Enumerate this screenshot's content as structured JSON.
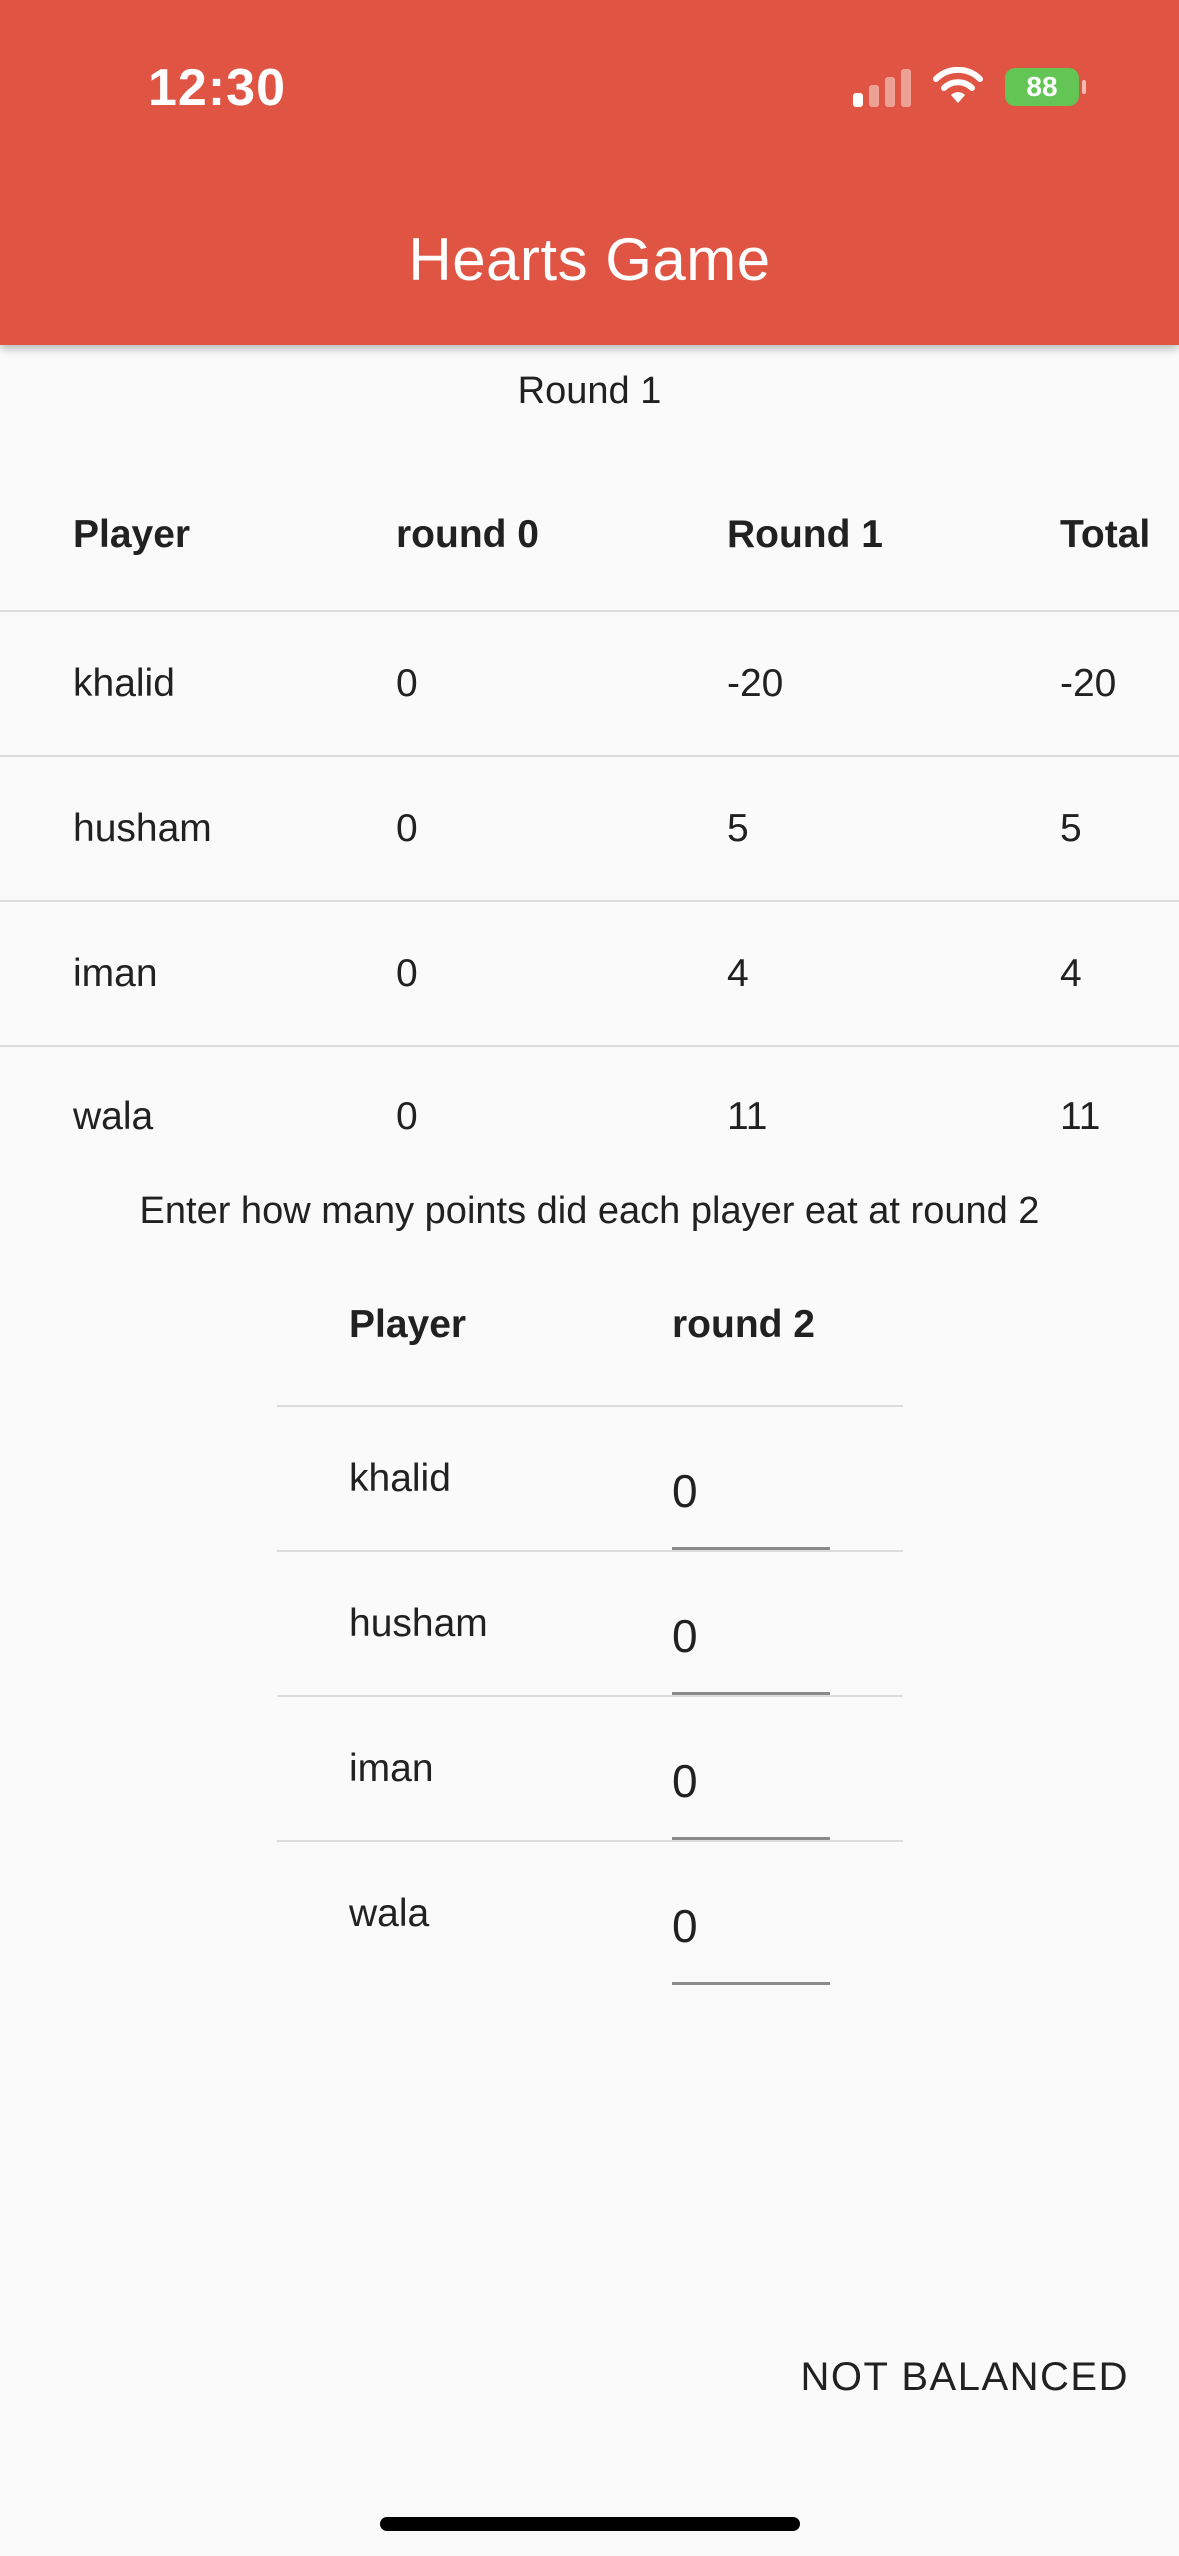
{
  "status_bar": {
    "time": "12:30",
    "battery": "88",
    "icons": [
      "cellular-signal-icon",
      "wifi-icon",
      "battery-charging-icon"
    ]
  },
  "app_bar": {
    "title": "Hearts Game",
    "color": "#e05443"
  },
  "round_caption": "Round 1",
  "score_table": {
    "headers": [
      "Player",
      "round 0",
      "Round 1",
      "Total"
    ],
    "rows": [
      [
        "khalid",
        "0",
        "-20",
        "-20"
      ],
      [
        "husham",
        "0",
        "5",
        "5"
      ],
      [
        "iman",
        "0",
        "4",
        "4"
      ],
      [
        "wala",
        "0",
        "11",
        "11"
      ]
    ]
  },
  "instructions": "Enter how many points did each player eat at round 2",
  "entry_table": {
    "headers": [
      "Player",
      "round 2"
    ],
    "rows": [
      {
        "player": "khalid",
        "value": "0"
      },
      {
        "player": "husham",
        "value": "0"
      },
      {
        "player": "iman",
        "value": "0"
      },
      {
        "player": "wala",
        "value": "0"
      }
    ]
  },
  "balance_status": "NOT BALANCED"
}
